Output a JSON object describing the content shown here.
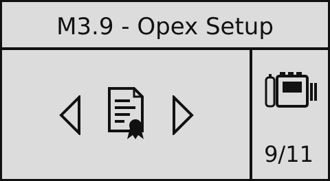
{
  "header": {
    "title": "M3.9 - Opex Setup"
  },
  "navigation": {
    "prev_icon": "triangle-left-outline-icon",
    "next_icon": "triangle-right-outline-icon",
    "center_icon": "document-certificate-icon"
  },
  "status": {
    "battery_icon": "battery-pack-icon",
    "page": "9/11"
  },
  "colors": {
    "background": "#dcdcdc",
    "foreground": "#111111"
  }
}
